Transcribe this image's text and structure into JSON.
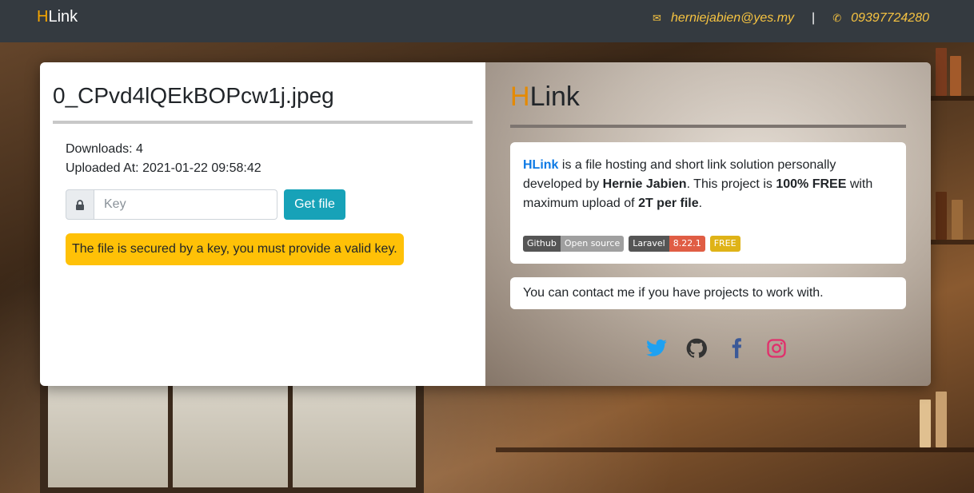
{
  "navbar": {
    "brand_h": "H",
    "brand_rest": "Link",
    "email": "herniejabien@yes.my",
    "separator": "|",
    "phone": "09397724280"
  },
  "file": {
    "name": "0_CPvd4lQEkBOPcw1j.jpeg",
    "downloads": "Downloads: 4",
    "uploaded_at": "Uploaded At: 2021-01-22 09:58:42",
    "key_placeholder": "Key",
    "get_button": "Get file",
    "alert": "The file is secured by a key, you must provide a valid key."
  },
  "about": {
    "brand_h": "H",
    "brand_rest": "Link",
    "link_text": "HLink",
    "text_1": " is a file hosting and short link solution personally developed by ",
    "author": "Hernie Jabien",
    "text_2": ". This project is ",
    "free_text": "100% FREE",
    "text_3": " with maximum upload of ",
    "upload_limit": "2T per file",
    "text_4": ".",
    "badges": [
      {
        "left": "Github",
        "right": "Open source"
      },
      {
        "left": "Laravel",
        "right": "8.22.1"
      },
      {
        "single": "FREE"
      }
    ],
    "contact_text": "You can contact me if you have projects to work with."
  },
  "icons": {
    "mail": "mail-icon",
    "phone": "phone-icon",
    "lock": "lock-icon",
    "socials": [
      "twitter-icon",
      "github-icon",
      "facebook-icon",
      "instagram-icon"
    ]
  },
  "colors": {
    "accent": "#f6a500",
    "navbar": "#343a40",
    "button": "#17a2b8",
    "alert": "#ffc107",
    "link": "#0d7ae5",
    "twitter": "#1da1f2",
    "github": "#333333",
    "facebook": "#3b5998",
    "instagram": "#e1306c"
  }
}
